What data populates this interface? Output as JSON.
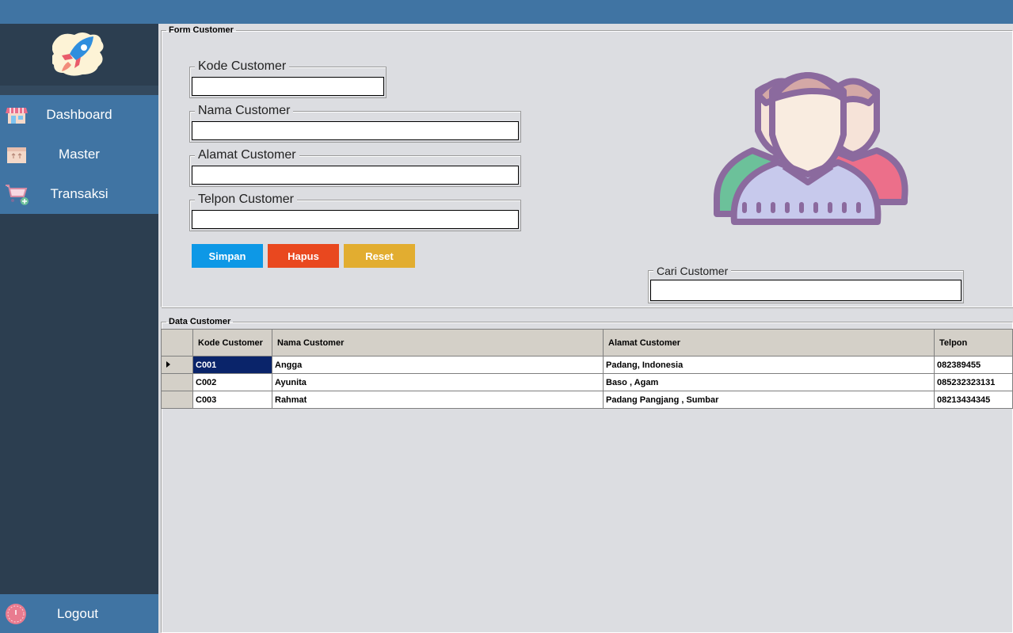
{
  "sidebar": {
    "logo_icon": "rocket-icon",
    "items": [
      {
        "label": "Dashboard",
        "icon": "store-icon"
      },
      {
        "label": "Master",
        "icon": "box-icon"
      },
      {
        "label": "Transaksi",
        "icon": "cart-icon"
      }
    ],
    "logout": {
      "label": "Logout",
      "icon": "power-icon"
    }
  },
  "form": {
    "legend": "Form Customer",
    "fields": {
      "kode": {
        "label": "Kode Customer",
        "value": ""
      },
      "nama": {
        "label": "Nama Customer",
        "value": ""
      },
      "alamat": {
        "label": "Alamat Customer",
        "value": ""
      },
      "telpon": {
        "label": "Telpon Customer",
        "value": ""
      }
    },
    "buttons": {
      "simpan": {
        "label": "Simpan",
        "color": "#0d98e6"
      },
      "hapus": {
        "label": "Hapus",
        "color": "#e9481f"
      },
      "reset": {
        "label": "Reset",
        "color": "#e2ad30"
      }
    },
    "search": {
      "label": "Cari Customer",
      "value": ""
    },
    "illustration_icon": "customer-group-icon"
  },
  "table": {
    "legend": "Data Customer",
    "columns": [
      "Kode Customer",
      "Nama Customer",
      "Alamat Customer",
      "Telpon"
    ],
    "rows": [
      {
        "kode": "C001",
        "nama": "Angga",
        "alamat": "Padang, Indonesia",
        "telpon": "082389455",
        "selected": true
      },
      {
        "kode": "C002",
        "nama": "Ayunita",
        "alamat": "Baso , Agam",
        "telpon": "085232323131",
        "selected": false
      },
      {
        "kode": "C003",
        "nama": "Rahmat",
        "alamat": "Padang Pangjang , Sumbar",
        "telpon": "08213434345",
        "selected": false
      }
    ]
  },
  "colors": {
    "accent": "#4074a3",
    "sidebar_bg": "#2c3e50",
    "selection": "#0a246a"
  }
}
